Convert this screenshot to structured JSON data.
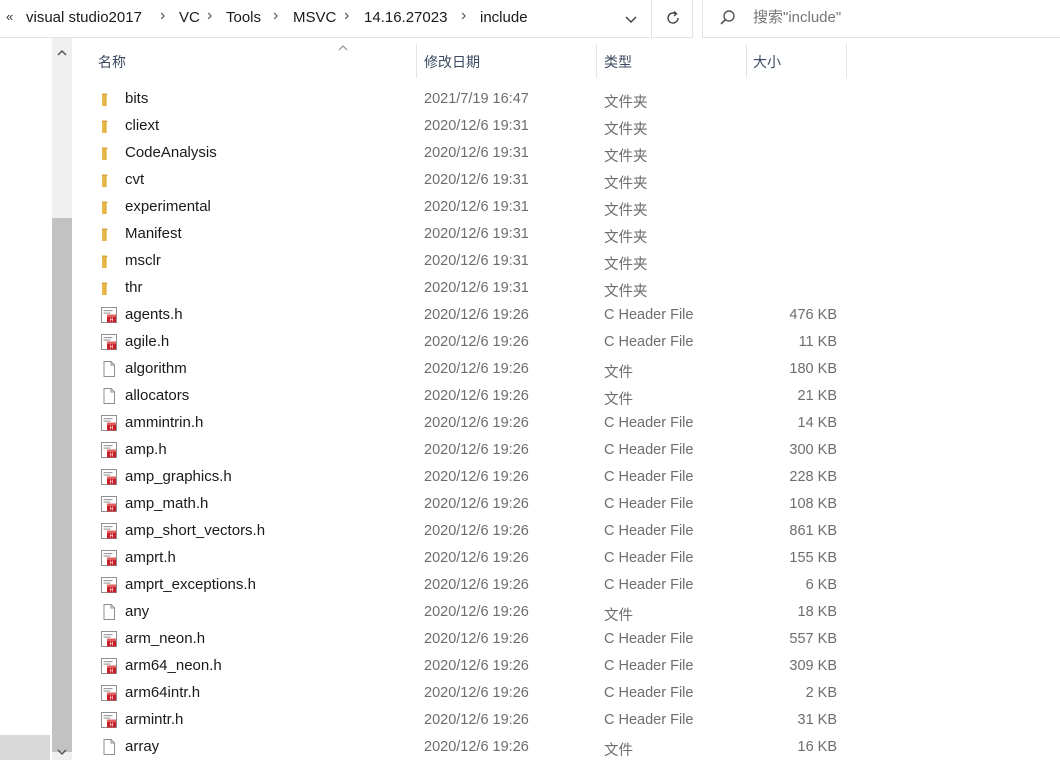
{
  "address_bar": {
    "overflow_glyph": "«",
    "breadcrumbs": [
      "visual studio2017",
      "VC",
      "Tools",
      "MSVC",
      "14.16.27023",
      "include"
    ],
    "separator_glyph": "›"
  },
  "search": {
    "placeholder": "搜索\"include\""
  },
  "columns": {
    "name": "名称",
    "date": "修改日期",
    "type": "类型",
    "size": "大小"
  },
  "files": [
    {
      "name": "bits",
      "date": "2021/7/19 16:47",
      "type": "文件夹",
      "size": "",
      "icon": "folder-icon"
    },
    {
      "name": "cliext",
      "date": "2020/12/6 19:31",
      "type": "文件夹",
      "size": "",
      "icon": "folder-icon"
    },
    {
      "name": "CodeAnalysis",
      "date": "2020/12/6 19:31",
      "type": "文件夹",
      "size": "",
      "icon": "folder-icon"
    },
    {
      "name": "cvt",
      "date": "2020/12/6 19:31",
      "type": "文件夹",
      "size": "",
      "icon": "folder-icon"
    },
    {
      "name": "experimental",
      "date": "2020/12/6 19:31",
      "type": "文件夹",
      "size": "",
      "icon": "folder-icon"
    },
    {
      "name": "Manifest",
      "date": "2020/12/6 19:31",
      "type": "文件夹",
      "size": "",
      "icon": "folder-icon"
    },
    {
      "name": "msclr",
      "date": "2020/12/6 19:31",
      "type": "文件夹",
      "size": "",
      "icon": "folder-icon"
    },
    {
      "name": "thr",
      "date": "2020/12/6 19:31",
      "type": "文件夹",
      "size": "",
      "icon": "folder-icon"
    },
    {
      "name": "agents.h",
      "date": "2020/12/6 19:26",
      "type": "C Header File",
      "size": "476 KB",
      "icon": "header-file-icon"
    },
    {
      "name": "agile.h",
      "date": "2020/12/6 19:26",
      "type": "C Header File",
      "size": "11 KB",
      "icon": "header-file-icon"
    },
    {
      "name": "algorithm",
      "date": "2020/12/6 19:26",
      "type": "文件",
      "size": "180 KB",
      "icon": "file-icon"
    },
    {
      "name": "allocators",
      "date": "2020/12/6 19:26",
      "type": "文件",
      "size": "21 KB",
      "icon": "file-icon"
    },
    {
      "name": "ammintrin.h",
      "date": "2020/12/6 19:26",
      "type": "C Header File",
      "size": "14 KB",
      "icon": "header-file-icon"
    },
    {
      "name": "amp.h",
      "date": "2020/12/6 19:26",
      "type": "C Header File",
      "size": "300 KB",
      "icon": "header-file-icon"
    },
    {
      "name": "amp_graphics.h",
      "date": "2020/12/6 19:26",
      "type": "C Header File",
      "size": "228 KB",
      "icon": "header-file-icon"
    },
    {
      "name": "amp_math.h",
      "date": "2020/12/6 19:26",
      "type": "C Header File",
      "size": "108 KB",
      "icon": "header-file-icon"
    },
    {
      "name": "amp_short_vectors.h",
      "date": "2020/12/6 19:26",
      "type": "C Header File",
      "size": "861 KB",
      "icon": "header-file-icon"
    },
    {
      "name": "amprt.h",
      "date": "2020/12/6 19:26",
      "type": "C Header File",
      "size": "155 KB",
      "icon": "header-file-icon"
    },
    {
      "name": "amprt_exceptions.h",
      "date": "2020/12/6 19:26",
      "type": "C Header File",
      "size": "6 KB",
      "icon": "header-file-icon"
    },
    {
      "name": "any",
      "date": "2020/12/6 19:26",
      "type": "文件",
      "size": "18 KB",
      "icon": "file-icon"
    },
    {
      "name": "arm_neon.h",
      "date": "2020/12/6 19:26",
      "type": "C Header File",
      "size": "557 KB",
      "icon": "header-file-icon"
    },
    {
      "name": "arm64_neon.h",
      "date": "2020/12/6 19:26",
      "type": "C Header File",
      "size": "309 KB",
      "icon": "header-file-icon"
    },
    {
      "name": "arm64intr.h",
      "date": "2020/12/6 19:26",
      "type": "C Header File",
      "size": "2 KB",
      "icon": "header-file-icon"
    },
    {
      "name": "armintr.h",
      "date": "2020/12/6 19:26",
      "type": "C Header File",
      "size": "31 KB",
      "icon": "header-file-icon"
    },
    {
      "name": "array",
      "date": "2020/12/6 19:26",
      "type": "文件",
      "size": "16 KB",
      "icon": "file-icon"
    }
  ],
  "colors": {
    "folder": "#e8b84a",
    "header_icon_red": "#c8202a",
    "header_text": "#3b4a61",
    "secondary_text": "#6d6d6d"
  }
}
